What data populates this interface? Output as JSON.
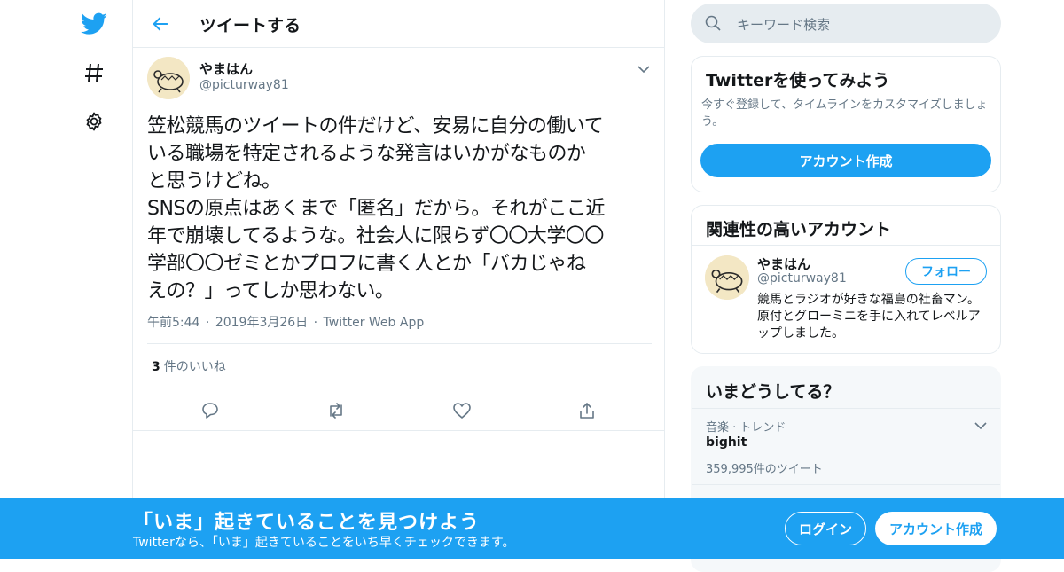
{
  "colors": {
    "accent": "#1da1f2",
    "text": "#14171a",
    "secondary": "#657786",
    "border": "#e6ecf0"
  },
  "nav": {
    "icons": [
      "twitter-bird-icon",
      "hashtag-icon",
      "gear-icon"
    ]
  },
  "header": {
    "title": "ツイートする"
  },
  "tweet": {
    "name": "やまはん",
    "handle": "@picturway81",
    "text": "笠松競馬のツイートの件だけど、安易に自分の働いて\nいる職場を特定されるような発言はいかがなものか\nと思うけどね。\nSNSの原点はあくまで「匿名」だから。それがここ近\n年で崩壊してるような。社会人に限らず〇〇大学〇〇\n学部〇〇ゼミとかプロフに書く人とか「バカじゃね\nえの？」ってしか思わない。",
    "time": "午前5:44",
    "date": "2019年3月26日",
    "source": "Twitter Web App",
    "sep": "·",
    "likes_count": "3",
    "likes_label": "件のいいね"
  },
  "search": {
    "placeholder": "キーワード検索"
  },
  "signup_card": {
    "title": "Twitterを使ってみよう",
    "desc": "今すぐ登録して、タイムラインをカスタマイズしましょう。",
    "button": "アカウント作成"
  },
  "related": {
    "title": "関連性の高いアカウント",
    "name": "やまはん",
    "handle": "@picturway81",
    "follow": "フォロー",
    "bio": "競馬とラジオが好きな福島の社畜マン。 原付とグローミニを手に入れてレベルアップしました。"
  },
  "trends": {
    "title": "いまどうしてる？",
    "meta": "音楽 · トレンド",
    "name": "bighit",
    "count": "359,995件のツイート"
  },
  "banner": {
    "title": "「いま」起きていることを見つけよう",
    "sub": "Twitterなら、「いま」起きていることをいち早くチェックできます。",
    "login": "ログイン",
    "signup": "アカウント作成"
  }
}
